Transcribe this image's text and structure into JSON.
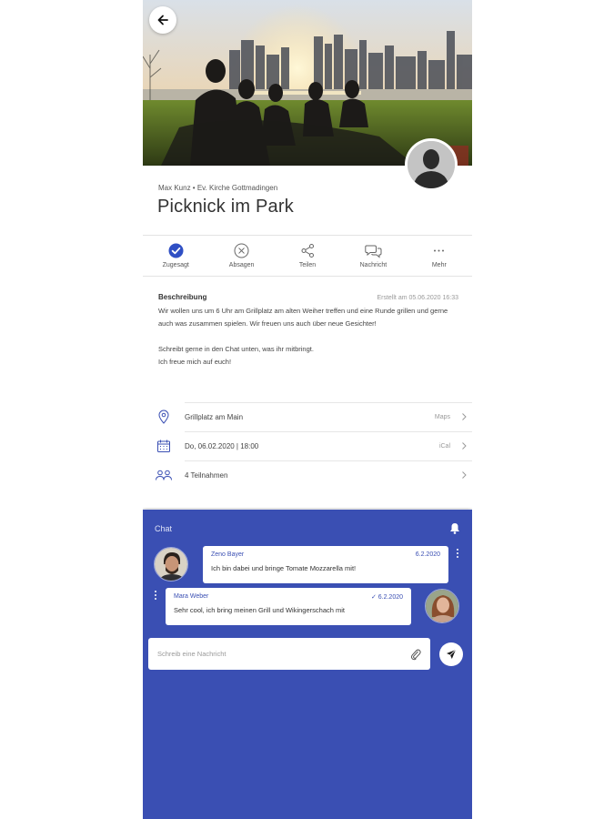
{
  "event": {
    "meta": "Max Kunz • Ev. Kirche Gottmadingen",
    "title": "Picknick im Park"
  },
  "actions": [
    {
      "label": "Zugesagt",
      "icon": "check-circle-icon",
      "active": true
    },
    {
      "label": "Absagen",
      "icon": "x-circle-icon"
    },
    {
      "label": "Teilen",
      "icon": "share-icon"
    },
    {
      "label": "Nachricht",
      "icon": "chat-bubbles-icon"
    },
    {
      "label": "Mehr",
      "icon": "more-icon"
    }
  ],
  "description": {
    "title": "Beschreibung",
    "created": "Erstellt am 05.06.2020 16:33",
    "body": "Wir wollen uns um 6 Uhr am Grillplatz am alten Weiher treffen und eine Runde grillen und gerne auch was zusammen spielen. Wir freuen uns auch über neue Gesichter!\n\nSchreibt gerne in den Chat unten, was ihr mitbringt.\nIch freue mich auf euch!"
  },
  "rows": [
    {
      "icon": "location-pin-icon",
      "text": "Grillplatz am Main",
      "aux": "Maps"
    },
    {
      "icon": "calendar-icon",
      "text": "Do, 06.02.2020 | 18:00",
      "aux": "iCal"
    },
    {
      "icon": "people-icon",
      "text": "4 Teilnahmen",
      "aux": ""
    }
  ],
  "chat": {
    "title": "Chat",
    "messages": [
      {
        "name": "Zeno Bayer",
        "date": "6.2.2020",
        "text": "Ich bin dabei und bringe Tomate Mozzarella mit!"
      },
      {
        "name": "Mara Weber",
        "date": "✓ 6.2.2020",
        "text": "Sehr cool, ich bring meinen Grill und Wikingerschach mit"
      }
    ],
    "composer_placeholder": "Schreib eine Nachricht"
  },
  "colors": {
    "accent": "#3a4fb3",
    "active": "#2f4fc4"
  }
}
